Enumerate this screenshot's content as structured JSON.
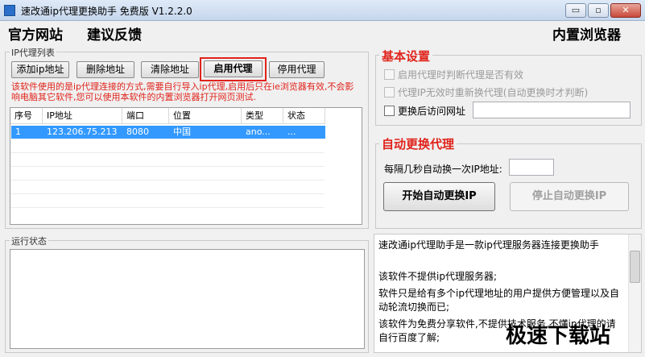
{
  "window": {
    "title": "速改通ip代理更换助手 免费版 V1.2.2.0",
    "controls": {
      "minimize": "▭",
      "maximize": "▫",
      "close": "✕"
    }
  },
  "toplinks": {
    "official": "官方网站",
    "feedback": "建议反馈",
    "browser": "内置浏览器"
  },
  "proxy_list": {
    "group_label": "IP代理列表",
    "buttons": {
      "add": "添加ip地址",
      "delete": "删除地址",
      "clear": "清除地址",
      "enable": "启用代理",
      "disable": "停用代理"
    },
    "notice": "该软件使用的是ip代理连接的方式,需要自行导入ip代理,启用后只在ie浏览器有效,不会影响电脑其它软件,您可以使用本软件的内置浏览器打开网页测试.",
    "columns": [
      "序号",
      "IP地址",
      "端口",
      "位置",
      "类型",
      "状态"
    ],
    "rows": [
      {
        "index": "1",
        "ip": "123.206.75.213",
        "port": "8080",
        "location": "中国",
        "type": "ano...",
        "status": "..."
      }
    ]
  },
  "basic_settings": {
    "title": "基本设置",
    "options": [
      {
        "label": "启用代理时判断代理是否有效",
        "checked": false,
        "enabled": false
      },
      {
        "label": "代理IP无效时重新换代理(自动更换时才判断)",
        "checked": false,
        "enabled": false
      },
      {
        "label": "更换后访问网址",
        "checked": false,
        "enabled": true
      }
    ],
    "url_value": ""
  },
  "auto_change": {
    "title": "自动更换代理",
    "interval_label": "每隔几秒自动换一次IP地址:",
    "interval_value": "",
    "start_button": "开始自动更换IP",
    "stop_button": "停止自动更换IP"
  },
  "run_status": {
    "label": "运行状态",
    "text": ""
  },
  "about": [
    "速改通ip代理助手是一款ip代理服务器连接更换助手",
    "该软件不提供ip代理服务器;",
    "软件只是给有多个ip代理地址的用户提供方便管理以及自动轮流切换而已;",
    "该软件为免费分享软件,不提供技术服务,不懂ip代理的请自行百度了解;"
  ],
  "watermark": "极速下载站",
  "colors": {
    "accent_red": "#e0231b",
    "selection_blue": "#3399ff"
  }
}
